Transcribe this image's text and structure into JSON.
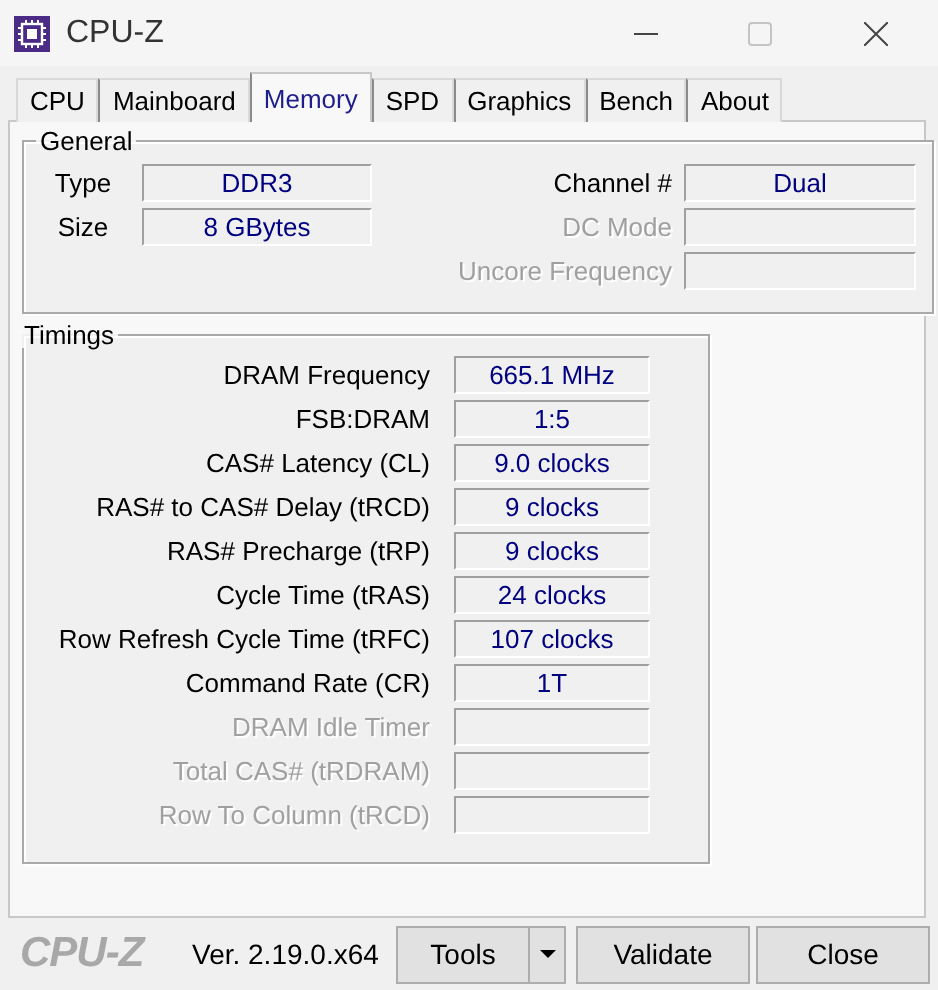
{
  "window": {
    "title": "CPU-Z"
  },
  "tabs": [
    {
      "label": "CPU",
      "selected": false
    },
    {
      "label": "Mainboard",
      "selected": false
    },
    {
      "label": "Memory",
      "selected": true
    },
    {
      "label": "SPD",
      "selected": false
    },
    {
      "label": "Graphics",
      "selected": false
    },
    {
      "label": "Bench",
      "selected": false
    },
    {
      "label": "About",
      "selected": false
    }
  ],
  "general": {
    "title": "General",
    "left": [
      {
        "label": "Type",
        "value": "DDR3",
        "disabled": false
      },
      {
        "label": "Size",
        "value": "8 GBytes",
        "disabled": false
      }
    ],
    "right": [
      {
        "label": "Channel #",
        "value": "Dual",
        "disabled": false
      },
      {
        "label": "DC Mode",
        "disabled": true
      },
      {
        "label": "Uncore Frequency",
        "disabled": true
      }
    ]
  },
  "timings": {
    "title": "Timings",
    "rows": [
      {
        "label": "DRAM Frequency",
        "value": "665.1 MHz",
        "disabled": false
      },
      {
        "label": "FSB:DRAM",
        "value": "1:5",
        "disabled": false
      },
      {
        "label": "CAS# Latency (CL)",
        "value": "9.0 clocks",
        "disabled": false
      },
      {
        "label": "RAS# to CAS# Delay (tRCD)",
        "value": "9 clocks",
        "disabled": false
      },
      {
        "label": "RAS# Precharge (tRP)",
        "value": "9 clocks",
        "disabled": false
      },
      {
        "label": "Cycle Time (tRAS)",
        "value": "24 clocks",
        "disabled": false
      },
      {
        "label": "Row Refresh Cycle Time (tRFC)",
        "value": "107 clocks",
        "disabled": false
      },
      {
        "label": "Command Rate (CR)",
        "value": "1T",
        "disabled": false
      },
      {
        "label": "DRAM Idle Timer",
        "disabled": true
      },
      {
        "label": "Total CAS# (tRDRAM)",
        "disabled": true
      },
      {
        "label": "Row To Column (tRCD)",
        "disabled": true
      }
    ]
  },
  "footer": {
    "logo": "CPU-Z",
    "version": "Ver. 2.19.0.x64",
    "buttons": [
      {
        "label": "Tools",
        "kind": "split"
      },
      {
        "label": "Validate",
        "kind": "plain"
      },
      {
        "label": "Close",
        "kind": "plain"
      }
    ]
  }
}
